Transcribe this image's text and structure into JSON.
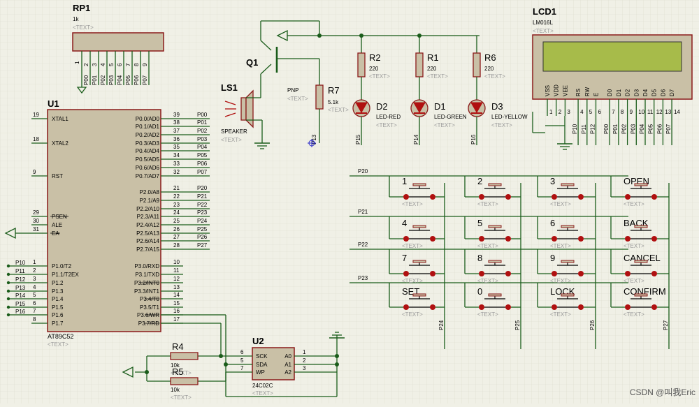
{
  "rp1": {
    "ref": "RP1",
    "value": "1k",
    "text": "<TEXT>",
    "pin1": "1",
    "pins": [
      "2",
      "3",
      "4",
      "5",
      "6",
      "7",
      "8",
      "9"
    ],
    "nets": [
      "P00",
      "P01",
      "P02",
      "P03",
      "P04",
      "P05",
      "P06",
      "P07"
    ]
  },
  "u1": {
    "ref": "U1",
    "part": "AT89C52",
    "text": "<TEXT>",
    "left_pins": [
      {
        "num": "19",
        "name": "XTAL1"
      },
      {
        "num": "18",
        "name": "XTAL2"
      },
      {
        "num": "9",
        "name": "RST"
      },
      {
        "num": "29",
        "name": "PSEN"
      },
      {
        "num": "30",
        "name": "ALE"
      },
      {
        "num": "31",
        "name": "EA"
      },
      {
        "num": "1",
        "name": "P1.0/T2",
        "net": "P10"
      },
      {
        "num": "2",
        "name": "P1.1/T2EX",
        "net": "P11"
      },
      {
        "num": "3",
        "name": "P1.2",
        "net": "P12"
      },
      {
        "num": "4",
        "name": "P1.3",
        "net": "P13"
      },
      {
        "num": "5",
        "name": "P1.4",
        "net": "P14"
      },
      {
        "num": "6",
        "name": "P1.5",
        "net": "P15"
      },
      {
        "num": "7",
        "name": "P1.6",
        "net": "P16"
      },
      {
        "num": "8",
        "name": "P1.7"
      }
    ],
    "right_pins": [
      {
        "num": "39",
        "name": "P0.0/AD0",
        "net": "P00"
      },
      {
        "num": "38",
        "name": "P0.1/AD1",
        "net": "P01"
      },
      {
        "num": "37",
        "name": "P0.2/AD2",
        "net": "P02"
      },
      {
        "num": "36",
        "name": "P0.3/AD3",
        "net": "P03"
      },
      {
        "num": "35",
        "name": "P0.4/AD4",
        "net": "P04"
      },
      {
        "num": "34",
        "name": "P0.5/AD5",
        "net": "P05"
      },
      {
        "num": "33",
        "name": "P0.6/AD6",
        "net": "P06"
      },
      {
        "num": "32",
        "name": "P0.7/AD7",
        "net": "P07"
      },
      {
        "num": "21",
        "name": "P2.0/A8",
        "net": "P20"
      },
      {
        "num": "22",
        "name": "P2.1/A9",
        "net": "P21"
      },
      {
        "num": "23",
        "name": "P2.2/A10",
        "net": "P22"
      },
      {
        "num": "24",
        "name": "P2.3/A11",
        "net": "P23"
      },
      {
        "num": "25",
        "name": "P2.4/A12",
        "net": "P24"
      },
      {
        "num": "26",
        "name": "P2.5/A13",
        "net": "P25"
      },
      {
        "num": "27",
        "name": "P2.6/A14",
        "net": "P26"
      },
      {
        "num": "28",
        "name": "P2.7/A15",
        "net": "P27"
      },
      {
        "num": "10",
        "name": "P3.0/RXD"
      },
      {
        "num": "11",
        "name": "P3.1/TXD"
      },
      {
        "num": "12",
        "name": "P3.2/INT0"
      },
      {
        "num": "13",
        "name": "P3.3/INT1"
      },
      {
        "num": "14",
        "name": "P3.4/T0"
      },
      {
        "num": "15",
        "name": "P3.5/T1"
      },
      {
        "num": "16",
        "name": "P3.6/WR"
      },
      {
        "num": "17",
        "name": "P3.7/RD"
      }
    ]
  },
  "q1": {
    "ref": "Q1",
    "type": "PNP"
  },
  "r7": {
    "ref": "R7",
    "value": "5.1k",
    "text": "<TEXT>",
    "net": "P13"
  },
  "ls1": {
    "ref": "LS1",
    "type": "SPEAKER",
    "text": "<TEXT>"
  },
  "leds": [
    {
      "r_ref": "R2",
      "r_val": "220",
      "ref": "D2",
      "type": "LED-RED",
      "net": "P15"
    },
    {
      "r_ref": "R1",
      "r_val": "220",
      "ref": "D1",
      "type": "LED-GREEN",
      "net": "P14"
    },
    {
      "r_ref": "R6",
      "r_val": "220",
      "ref": "D3",
      "type": "LED-YELLOW",
      "net": "P16"
    }
  ],
  "lcd": {
    "ref": "LCD1",
    "part": "LM016L",
    "text": "<TEXT>",
    "pins": [
      {
        "name": "VSS",
        "num": "1"
      },
      {
        "name": "VDD",
        "num": "2"
      },
      {
        "name": "VEE",
        "num": "3"
      },
      {
        "name": "RS",
        "num": "4",
        "net": "P10"
      },
      {
        "name": "RW",
        "num": "5",
        "net": "P11"
      },
      {
        "name": "E",
        "num": "6",
        "net": "P12"
      },
      {
        "name": "D0",
        "num": "7",
        "net": "P00"
      },
      {
        "name": "D1",
        "num": "8",
        "net": "P01"
      },
      {
        "name": "D2",
        "num": "9",
        "net": "P02"
      },
      {
        "name": "D3",
        "num": "10",
        "net": "P03"
      },
      {
        "name": "D4",
        "num": "11",
        "net": "P04"
      },
      {
        "name": "D5",
        "num": "12",
        "net": "P05"
      },
      {
        "name": "D6",
        "num": "13",
        "net": "P06"
      },
      {
        "name": "D7",
        "num": "14",
        "net": "P07"
      }
    ]
  },
  "keypad": {
    "rows": [
      "P20",
      "P21",
      "P22",
      "P23"
    ],
    "cols": [
      "P24",
      "P25",
      "P26",
      "P27"
    ],
    "keys": [
      "1",
      "2",
      "3",
      "OPEN",
      "4",
      "5",
      "6",
      "BACK",
      "7",
      "8",
      "9",
      "CANCEL",
      "SET",
      "0",
      "LOCK",
      "CONFIRM"
    ],
    "text": "<TEXT>"
  },
  "eeprom": {
    "ref": "U2",
    "part": "24C02C",
    "text": "<TEXT>",
    "left_pins": [
      {
        "num": "6",
        "name": "SCK"
      },
      {
        "num": "5",
        "name": "SDA"
      },
      {
        "num": "7",
        "name": "WP"
      }
    ],
    "right_pins": [
      {
        "num": "1",
        "name": "A0"
      },
      {
        "num": "2",
        "name": "A1"
      },
      {
        "num": "3",
        "name": "A2"
      }
    ]
  },
  "pullups": [
    {
      "ref": "R4",
      "value": "10k",
      "text": "<TEXT>"
    },
    {
      "ref": "R5",
      "value": "10k",
      "text": "<TEXT>"
    }
  ],
  "watermark": "CSDN @叫我Eric",
  "colors": {
    "wire": "#1a5c1a",
    "body": "#c9c0a6",
    "outline": "#8b1a1a",
    "label": "#0b0b0b",
    "hidden": "#999999",
    "led": "#b01010",
    "lcd": "#a7bb4a",
    "bg": "#f0f0e6"
  }
}
